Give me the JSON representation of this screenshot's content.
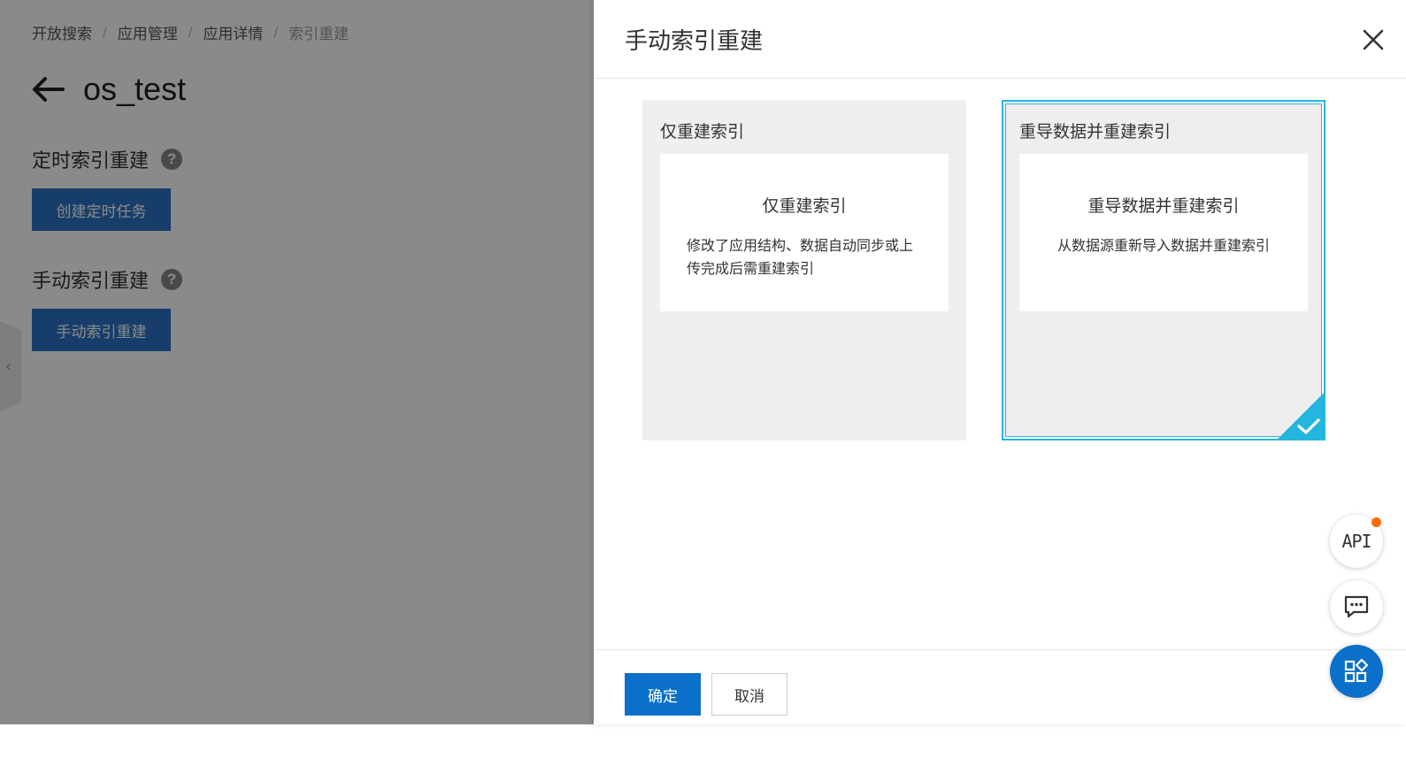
{
  "breadcrumb": {
    "items": [
      "开放搜索",
      "应用管理",
      "应用详情"
    ],
    "current": "索引重建",
    "separator": "/"
  },
  "page": {
    "title": "os_test",
    "scheduled_section": "定时索引重建",
    "create_scheduled_button": "创建定时任务",
    "manual_section": "手动索引重建",
    "manual_button": "手动索引重建",
    "help_glyph": "?",
    "collapse_glyph": "‹"
  },
  "drawer": {
    "title": "手动索引重建",
    "options": [
      {
        "title": "仅重建索引",
        "inner_title": "仅重建索引",
        "description": "修改了应用结构、数据自动同步或上传完成后需重建索引",
        "selected": false
      },
      {
        "title": "重导数据并重建索引",
        "inner_title": "重导数据并重建索引",
        "description": "从数据源重新导入数据并重建索引",
        "selected": true
      }
    ],
    "ok_label": "确定",
    "cancel_label": "取消"
  },
  "float_buttons": {
    "api_label": "API",
    "icons": [
      "api-icon",
      "chat-icon",
      "apps-icon"
    ]
  },
  "colors": {
    "primary": "#0a70c9",
    "selected_border": "#25b6e0",
    "notification_dot": "#ff6a00"
  }
}
